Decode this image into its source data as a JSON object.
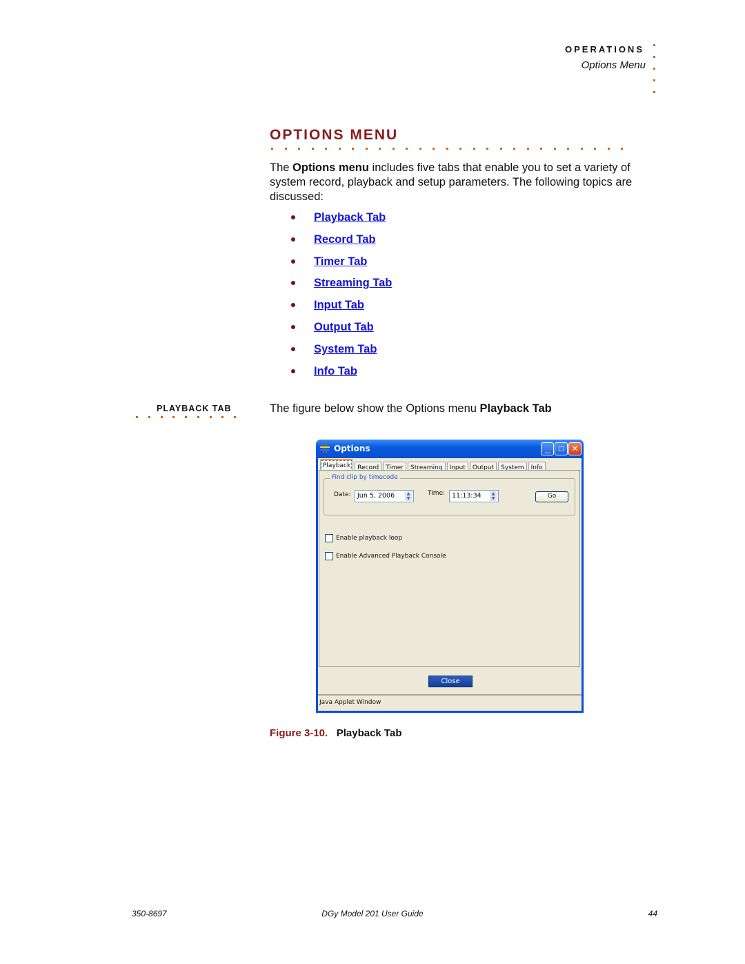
{
  "header": {
    "section": "OPERATIONS",
    "subsection": "Options Menu"
  },
  "title": "OPTIONS MENU",
  "intro": {
    "before": "The ",
    "bold": "Options menu",
    "after": " includes five tabs that enable you to set a variety of system record, playback and setup parameters. The following topics are discussed:"
  },
  "toc": [
    "Playback Tab",
    "Record Tab",
    "Timer Tab",
    "Streaming Tab",
    "Input Tab",
    "Output Tab",
    "System Tab",
    "Info Tab"
  ],
  "side_heading": "PLAYBACK TAB",
  "figure_intro": {
    "text": "The figure below show the Options menu ",
    "bold": "Playback Tab"
  },
  "window": {
    "title": "Options",
    "tabs": [
      "Playback",
      "Record",
      "Timer",
      "Streaming",
      "Input",
      "Output",
      "System",
      "Info"
    ],
    "active_tab": "Playback",
    "group_label": "Find clip by timecode",
    "date_label": "Date:",
    "date_value": "Jun 5, 2006",
    "time_label": "Time:",
    "time_value": "11:13:34",
    "go_label": "Go",
    "checkboxes": [
      {
        "label": "Enable playback loop",
        "checked": false
      },
      {
        "label": "Enable Advanced Playback Console",
        "checked": false
      }
    ],
    "close_label": "Close",
    "status": "Java Applet Window"
  },
  "caption": {
    "number": "Figure 3-10.",
    "text": "Playback Tab"
  },
  "footer": {
    "doc_number": "350-8697",
    "guide": "DGy Model 201 User Guide",
    "page": "44"
  },
  "colors": {
    "title": "#8b1a1a",
    "link": "#1515d6",
    "dots": "#c8691c"
  }
}
